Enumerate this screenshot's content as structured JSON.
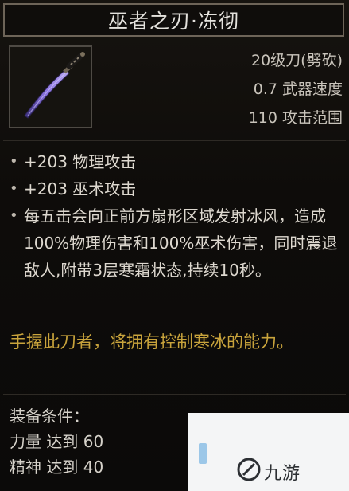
{
  "item": {
    "name": "巫者之刃·冻彻",
    "icon": "purple-blade-icon",
    "stats": [
      "20级刀(劈砍)",
      "0.7 武器速度",
      "110 攻击范围"
    ],
    "attributes": [
      "+203 物理攻击",
      "+203 巫术攻击",
      "每五击会向正前方扇形区域发射冰风，造成100%物理伤害和100%巫术伤害，同时震退敌人,附带3层寒霜状态,持续10秒。"
    ],
    "flavor": "手握此刀者，将拥有控制寒冰的能力。",
    "requirements": {
      "header": "装备条件：",
      "lines": [
        "力量 达到 60",
        "精神 达到 40"
      ]
    }
  },
  "watermark": {
    "text": "九游",
    "icon": "nine-game-logo-icon"
  },
  "colors": {
    "flavor": "#c9a43c",
    "title_border": "#6d6458",
    "blade": "#7a63c9"
  }
}
